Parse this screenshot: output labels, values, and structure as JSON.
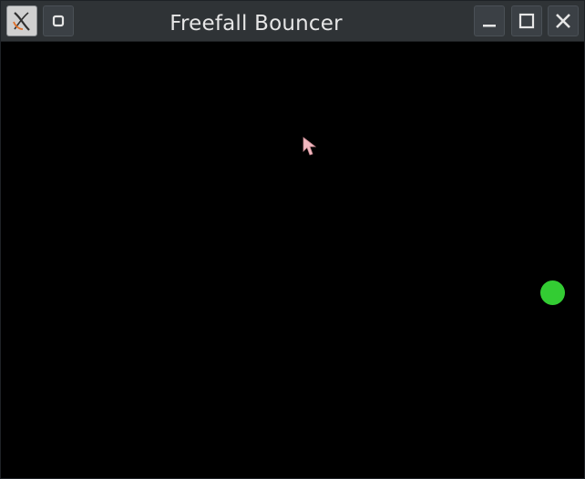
{
  "window": {
    "title": "Freefall Bouncer"
  },
  "titlebar": {
    "app_icon": "x-app-icon",
    "menu_icon": "window-menu-icon",
    "buttons": [
      {
        "name": "minimize",
        "icon": "minimize-icon"
      },
      {
        "name": "maximize",
        "icon": "maximize-icon"
      },
      {
        "name": "close",
        "icon": "close-icon"
      }
    ]
  },
  "canvas": {
    "background": "#000000",
    "ball_color": "#33cc33",
    "cursor_color": "#f2b8c0"
  }
}
